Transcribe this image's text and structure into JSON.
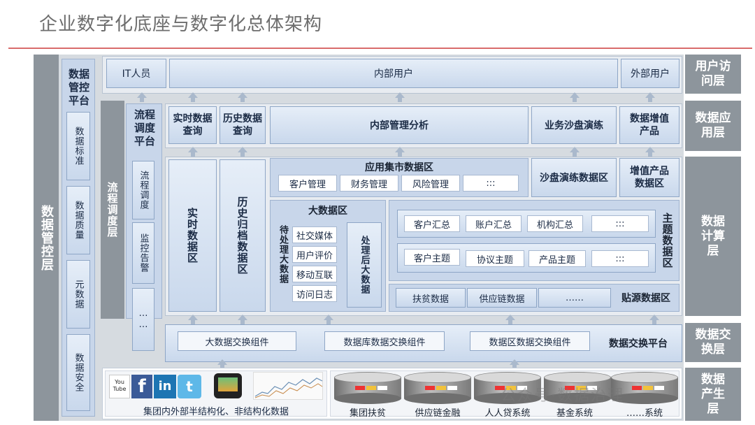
{
  "title": "企业数字化底座与数字化总体架构",
  "governance": {
    "outer_label": "数据管控层",
    "platform_title": "数据管控平台",
    "items": [
      "数据标准",
      "数据质量",
      "元数据",
      "数据安全"
    ]
  },
  "scheduling": {
    "outer_label": "流程调度层",
    "platform_title": "流程调度平台",
    "items": [
      "流程调度",
      "监控告警",
      "……"
    ]
  },
  "layers": {
    "user_access": "用户访问层",
    "data_app": "数据应用层",
    "data_compute": "数据计算层",
    "data_exchange": "数据交换层",
    "data_produce": "数据产生层"
  },
  "user_access": {
    "it_staff": "IT人员",
    "internal_users": "内部用户",
    "external_users": "外部用户"
  },
  "data_app": {
    "realtime_query": "实时数据查询",
    "history_query": "历史数据查询",
    "internal_analysis": "内部管理分析",
    "sandbox": "业务沙盘演练",
    "value_added": "数据增值产品"
  },
  "compute": {
    "realtime_zone": "实时数据区",
    "history_zone": "历史归档数据区",
    "app_market": {
      "title": "应用集市数据区",
      "items": [
        "客户管理",
        "财务管理",
        "风险管理",
        ":::"
      ]
    },
    "sandbox_zone": "沙盘演练数据区",
    "value_zone": "增值产品数据区",
    "bigdata": {
      "title": "大数据区",
      "pending": "待处理大数据",
      "items": [
        "社交媒体",
        "用户评价",
        "移动互联",
        "访问日志"
      ],
      "processed": "处理后大数据"
    },
    "topic": {
      "title": "主题数据区",
      "row1": [
        "客户汇总",
        "账户汇总",
        "机构汇总",
        ":::"
      ],
      "row2": [
        "客户主题",
        "协议主题",
        "产品主题",
        ":::"
      ]
    },
    "source": {
      "items": [
        "扶贫数据",
        "供应链数据",
        "……"
      ],
      "title": "贴源数据区"
    }
  },
  "exchange": {
    "components": [
      "大数据交换组件",
      "数据库数据交换组件",
      "数据区数据交换组件"
    ],
    "platform": "数据交换平台"
  },
  "produce": {
    "social_icons": [
      "You Tube",
      "f",
      "in",
      "t"
    ],
    "semi_structured": "集团内外部半结构化、非结构化数据",
    "systems": [
      "集团扶贫",
      "供应链金融",
      "人人贷系统",
      "基金系统",
      "……系统"
    ]
  },
  "watermark": "公众号·数据治理"
}
